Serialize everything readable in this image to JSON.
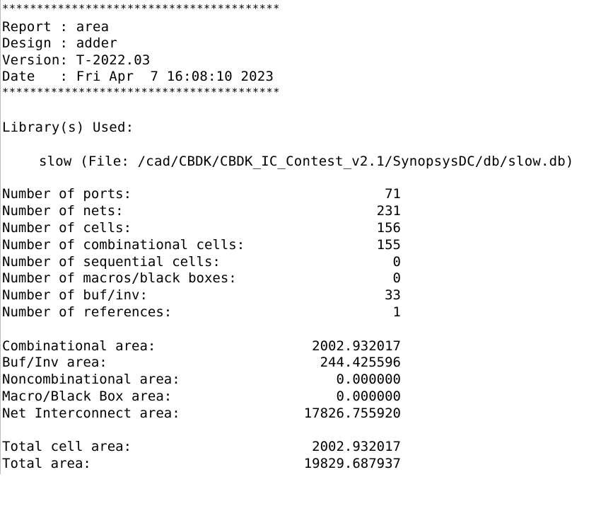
{
  "report": {
    "stars_top": "****************************************",
    "report_line": "Report : area",
    "design_line": "Design : adder",
    "version_line": "Version: T-2022.03",
    "date_line": "Date   : Fri Apr  7 16:08:10 2023",
    "stars_bottom": "****************************************",
    "library_heading": "Library(s) Used:",
    "library_entry": "slow (File: /cad/CBDK/CBDK_IC_Contest_v2.1/SynopsysDC/db/slow.db)",
    "counts": [
      {
        "label": "Number of ports:",
        "value": "71"
      },
      {
        "label": "Number of nets:",
        "value": "231"
      },
      {
        "label": "Number of cells:",
        "value": "156"
      },
      {
        "label": "Number of combinational cells:",
        "value": "155"
      },
      {
        "label": "Number of sequential cells:",
        "value": "0"
      },
      {
        "label": "Number of macros/black boxes:",
        "value": "0"
      },
      {
        "label": "Number of buf/inv:",
        "value": "33"
      },
      {
        "label": "Number of references:",
        "value": "1"
      }
    ],
    "areas": [
      {
        "label": "Combinational area:",
        "value": "2002.932017"
      },
      {
        "label": "Buf/Inv area:",
        "value": "244.425596"
      },
      {
        "label": "Noncombinational area:",
        "value": "0.000000"
      },
      {
        "label": "Macro/Black Box area:",
        "value": "0.000000"
      },
      {
        "label": "Net Interconnect area:",
        "value": "17826.755920"
      }
    ],
    "totals": [
      {
        "label": "Total cell area:",
        "value": "2002.932017"
      },
      {
        "label": "Total area:",
        "value": "19829.687937"
      }
    ]
  }
}
